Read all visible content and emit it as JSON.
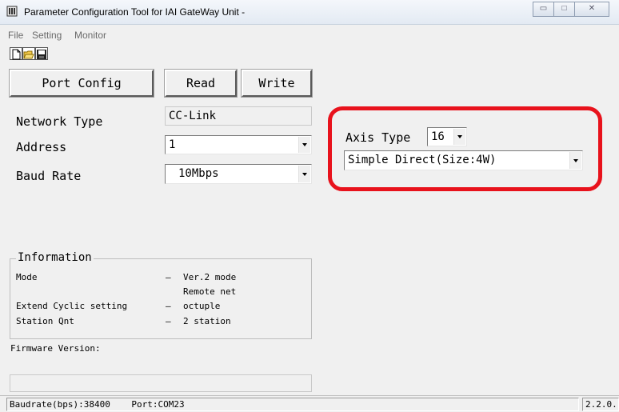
{
  "window": {
    "title": "Parameter Configuration Tool for IAI GateWay Unit -",
    "controls": {
      "minimize": "▭",
      "maximize": "□",
      "close": "✕"
    }
  },
  "menu": {
    "items": [
      "File",
      "Setting",
      "Monitor"
    ]
  },
  "toolbar": {
    "icons": [
      "new-file-icon",
      "open-folder-icon",
      "save-disk-icon"
    ]
  },
  "buttons": {
    "port_config": "Port Config",
    "read": "Read",
    "write": "Write"
  },
  "network": {
    "network_type_label": "Network Type",
    "network_type_value": "CC-Link",
    "address_label": "Address",
    "address_value": "1",
    "baud_rate_label": "Baud Rate",
    "baud_rate_value": "10Mbps"
  },
  "axis": {
    "axis_type_label": "Axis Type",
    "axis_type_value": "16",
    "mode_value": "Simple Direct(Size:4W)"
  },
  "information": {
    "title": "Information",
    "rows": [
      {
        "key": "Mode",
        "dash": "—",
        "value": "Ver.2 mode"
      },
      {
        "key": "",
        "dash": "",
        "value": "Remote net"
      },
      {
        "key": "Extend Cyclic setting",
        "dash": "—",
        "value": "octuple"
      },
      {
        "key": "Station Qnt",
        "dash": "—",
        "value": "2 station"
      }
    ]
  },
  "firmware": {
    "label": "Firmware Version:",
    "value": ""
  },
  "status": {
    "baudrate": "Baudrate(bps):38400",
    "port": "Port:COM23",
    "version": "2.2.0."
  },
  "colors": {
    "highlight": "#e8121c",
    "window_bg": "#f0f0f0"
  }
}
